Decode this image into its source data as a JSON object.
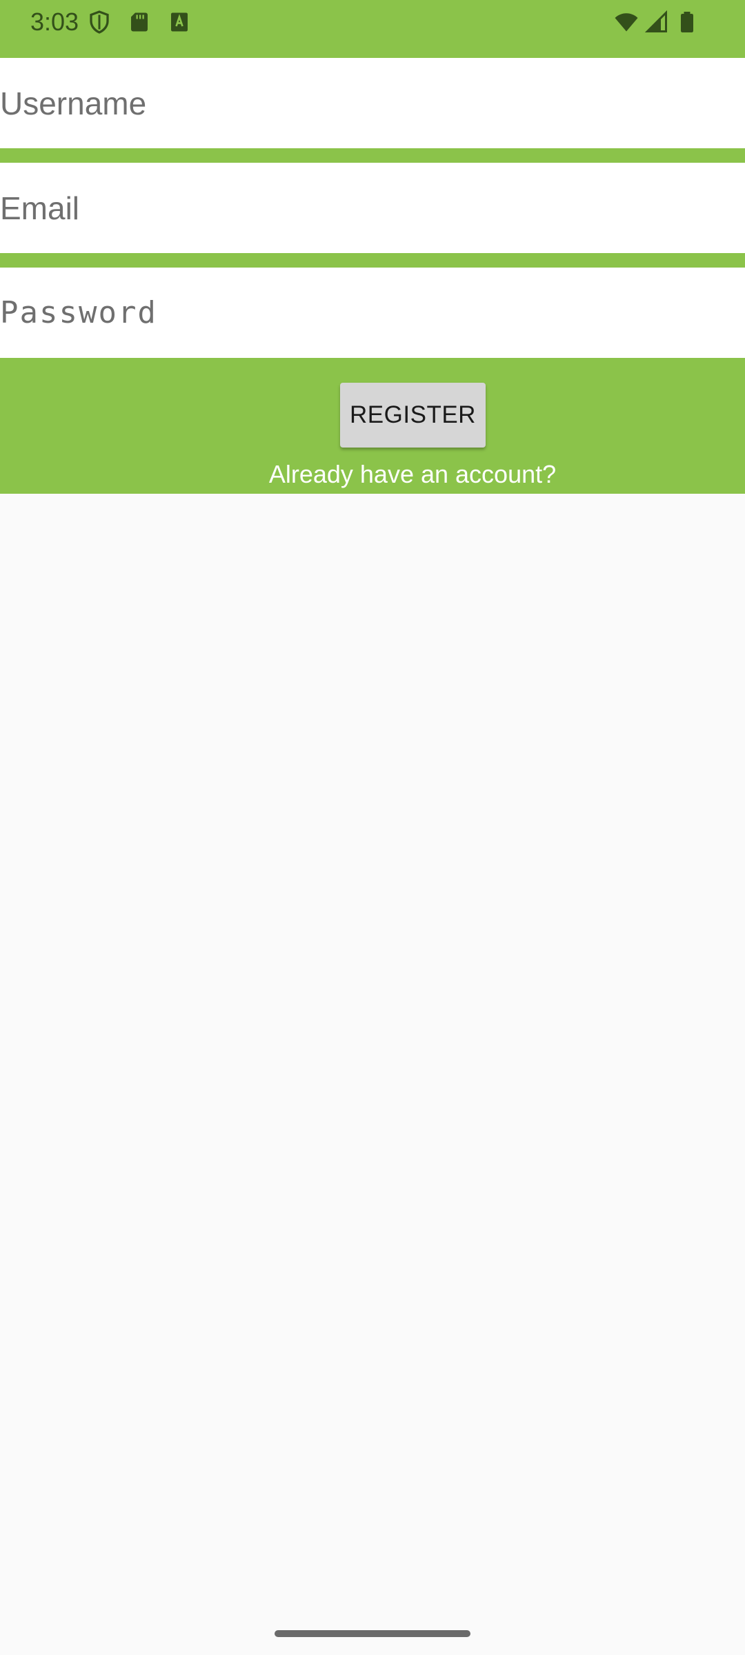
{
  "status_bar": {
    "time": "3:03",
    "left_icons": [
      "shield-icon",
      "sd-card-icon",
      "keyboard-a-icon"
    ],
    "right_icons": [
      "wifi-icon",
      "cell-signal-icon",
      "battery-icon"
    ]
  },
  "form": {
    "username": {
      "placeholder": "Username",
      "value": ""
    },
    "email": {
      "placeholder": "Email",
      "value": ""
    },
    "password": {
      "placeholder": "Password",
      "value": ""
    }
  },
  "actions": {
    "register_label": "REGISTER",
    "login_link": "Already have an account?"
  },
  "colors": {
    "accent_green": "#8bc34a",
    "background": "#fafafa",
    "field_background": "#ffffff",
    "button_background": "#d6d6d6"
  }
}
